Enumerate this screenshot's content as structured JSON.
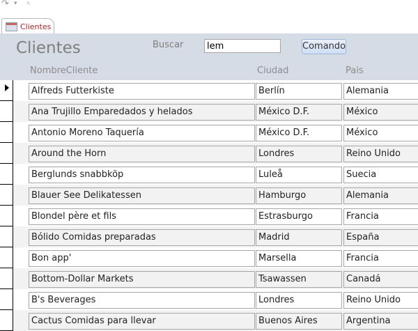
{
  "tab": {
    "label": "Clientes"
  },
  "form": {
    "title": "Clientes",
    "search_label": "Buscar",
    "search_value": "lem",
    "command_label": "Comando"
  },
  "columns": [
    "NombreCliente",
    "Ciudad",
    "Pais"
  ],
  "rows": [
    [
      "Alfreds Futterkiste",
      "Berlín",
      "Alemania"
    ],
    [
      "Ana Trujillo Emparedados y helados",
      "México D.F.",
      "México"
    ],
    [
      "Antonio Moreno Taquería",
      "México D.F.",
      "México"
    ],
    [
      "Around the Horn",
      "Londres",
      "Reino Unido"
    ],
    [
      "Berglunds snabbköp",
      "Luleå",
      "Suecia"
    ],
    [
      "Blauer See Delikatessen",
      "Hamburgo",
      "Alemania"
    ],
    [
      "Blondel père et fils",
      "Estrasburgo",
      "Francia"
    ],
    [
      "Bólido Comidas preparadas",
      "Madrid",
      "España"
    ],
    [
      "Bon app'",
      "Marsella",
      "Francia"
    ],
    [
      "Bottom-Dollar Markets",
      "Tsawassen",
      "Canadá"
    ],
    [
      "B's Beverages",
      "Londres",
      "Reino Unido"
    ],
    [
      "Cactus Comidas para llevar",
      "Buenos Aires",
      "Argentina"
    ]
  ]
}
